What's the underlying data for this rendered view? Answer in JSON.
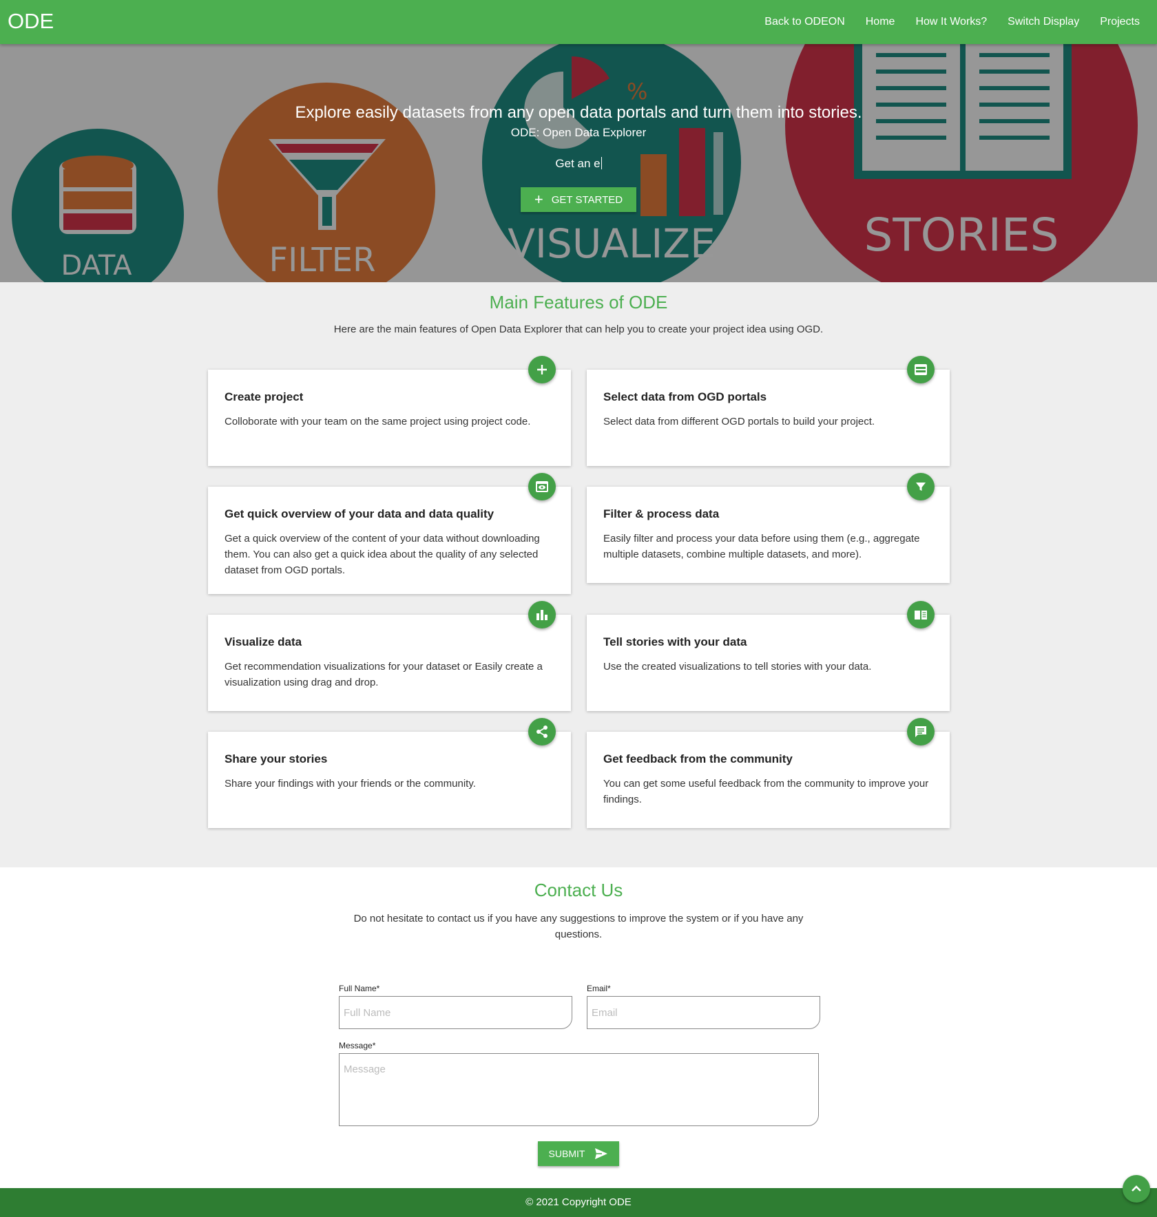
{
  "header": {
    "brand": "ODE",
    "nav": [
      "Back to ODEON",
      "Home",
      "How It Works?",
      "Switch Display",
      "Projects"
    ]
  },
  "hero": {
    "title": "Explore easily datasets from any open data portals and turn them into stories.",
    "subtitle": "ODE: Open Data Explorer",
    "typed_text": "Get an e",
    "cta_label": "GET STARTED",
    "background_labels": [
      "DATA",
      "FILTER",
      "VISUALIZE",
      "STORIES"
    ],
    "background_percent": "%"
  },
  "features": {
    "title": "Main Features of ODE",
    "description": "Here are the main features of Open Data Explorer that can help you to create your project idea using OGD.",
    "items": [
      {
        "title": "Create project",
        "text": "Colloborate with your team on the same project using project code.",
        "icon": "plus-icon"
      },
      {
        "title": "Select data from OGD portals",
        "text": "Select data from different OGD portals to build your project.",
        "icon": "table-icon"
      },
      {
        "title": "Get quick overview of your data and data quality",
        "text": "Get a quick overview of the content of your data without downloading them. You can also get a quick idea about the quality of any selected dataset from OGD portals.",
        "icon": "preview-icon"
      },
      {
        "title": "Filter & process data",
        "text": "Easily filter and process your data before using them (e.g., aggregate multiple datasets, combine multiple datasets, and more).",
        "icon": "filter-icon"
      },
      {
        "title": "Visualize data",
        "text": "Get recommendation visualizations for your dataset or Easily create a visualization using drag and drop.",
        "icon": "bar-chart-icon"
      },
      {
        "title": "Tell stories with your data",
        "text": "Use the created visualizations to tell stories with your data.",
        "icon": "book-icon"
      },
      {
        "title": "Share your stories",
        "text": "Share your findings with your friends or the community.",
        "icon": "share-icon"
      },
      {
        "title": "Get feedback from the community",
        "text": "You can get some useful feedback from the community to improve your findings.",
        "icon": "comment-icon"
      }
    ]
  },
  "contact": {
    "title": "Contact Us",
    "description": "Do not hesitate to contact us if you have any suggestions to improve the system or if you have any questions.",
    "full_name_label": "Full Name*",
    "full_name_placeholder": "Full Name",
    "email_label": "Email*",
    "email_placeholder": "Email",
    "message_label": "Message*",
    "message_placeholder": "Message",
    "submit_label": "SUBMIT"
  },
  "footer": {
    "copyright": "© 2021 Copyright ODE"
  },
  "colors": {
    "primary": "#4caf50",
    "footer": "#2e7d32",
    "teal": "#1d8a80",
    "orange": "#e07a3a",
    "red": "#d0334a"
  }
}
